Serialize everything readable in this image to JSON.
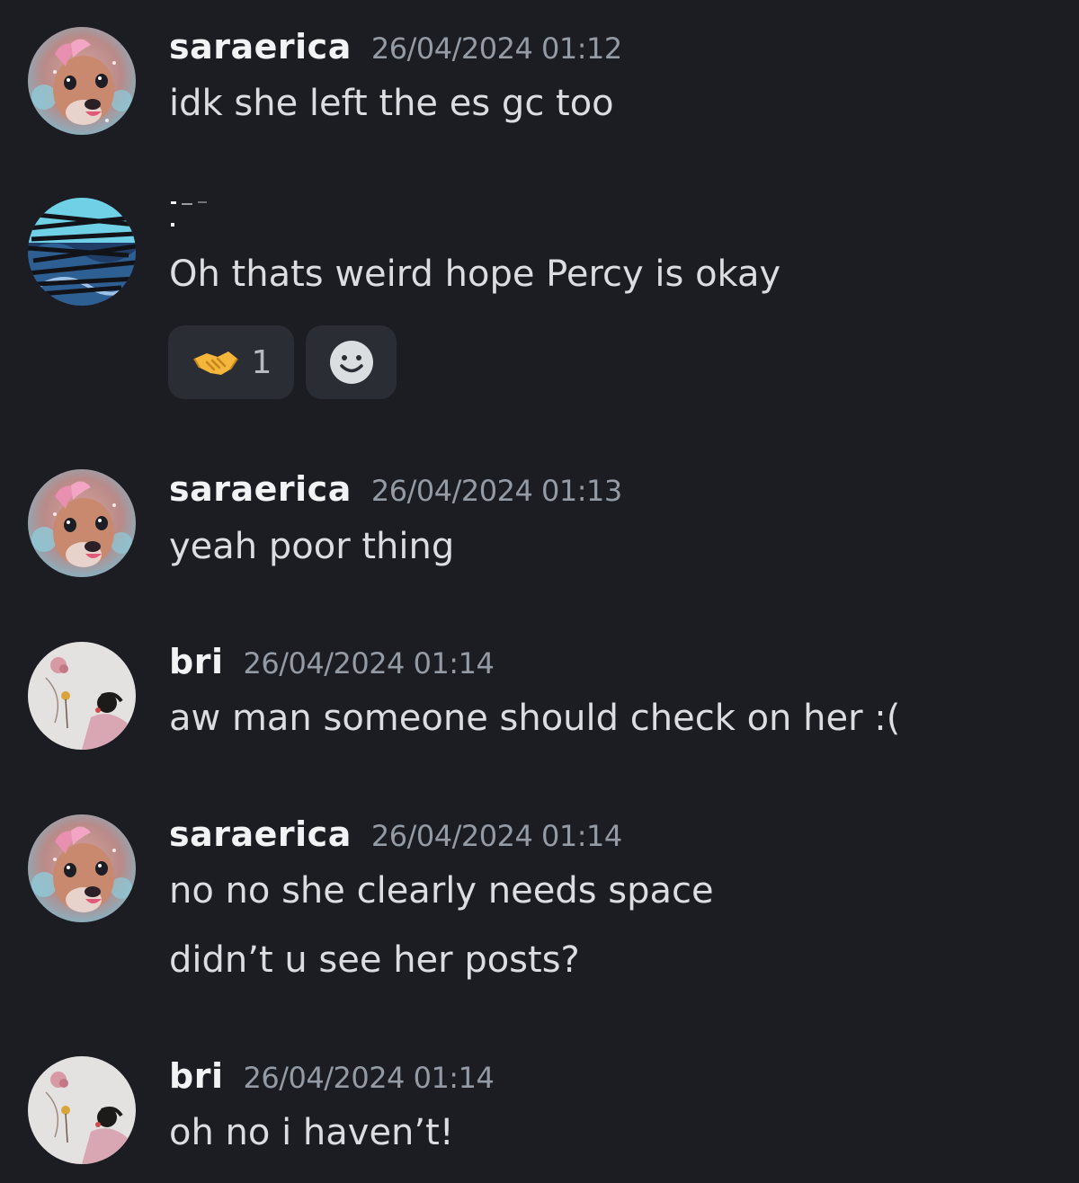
{
  "messages": [
    {
      "username": "saraerica",
      "timestamp": "26/04/2024 01:12",
      "lines": [
        "idk she left the es gc too"
      ]
    },
    {
      "username": "",
      "timestamp": "",
      "lines": [
        "Oh thats weird hope Percy is okay"
      ],
      "reactions": [
        {
          "emoji": "handshake-emoji",
          "count": "1"
        },
        {
          "emoji": "add-reaction-icon",
          "count": ""
        }
      ]
    },
    {
      "username": "saraerica",
      "timestamp": "26/04/2024 01:13",
      "lines": [
        "yeah poor thing"
      ]
    },
    {
      "username": "bri",
      "timestamp": "26/04/2024 01:14",
      "lines": [
        "aw man someone should check on her :("
      ]
    },
    {
      "username": "saraerica",
      "timestamp": "26/04/2024 01:14",
      "lines": [
        "no no she clearly needs space",
        "didn’t u see her posts?"
      ]
    },
    {
      "username": "bri",
      "timestamp": "26/04/2024 01:14",
      "lines": [
        "oh no i haven’t!"
      ]
    }
  ],
  "colors": {
    "background": "#1c1d23",
    "username": "#f2f3f5",
    "timestamp": "#949ba4",
    "message_text": "#dbdee1",
    "reaction_bg": "#2b2d35"
  }
}
